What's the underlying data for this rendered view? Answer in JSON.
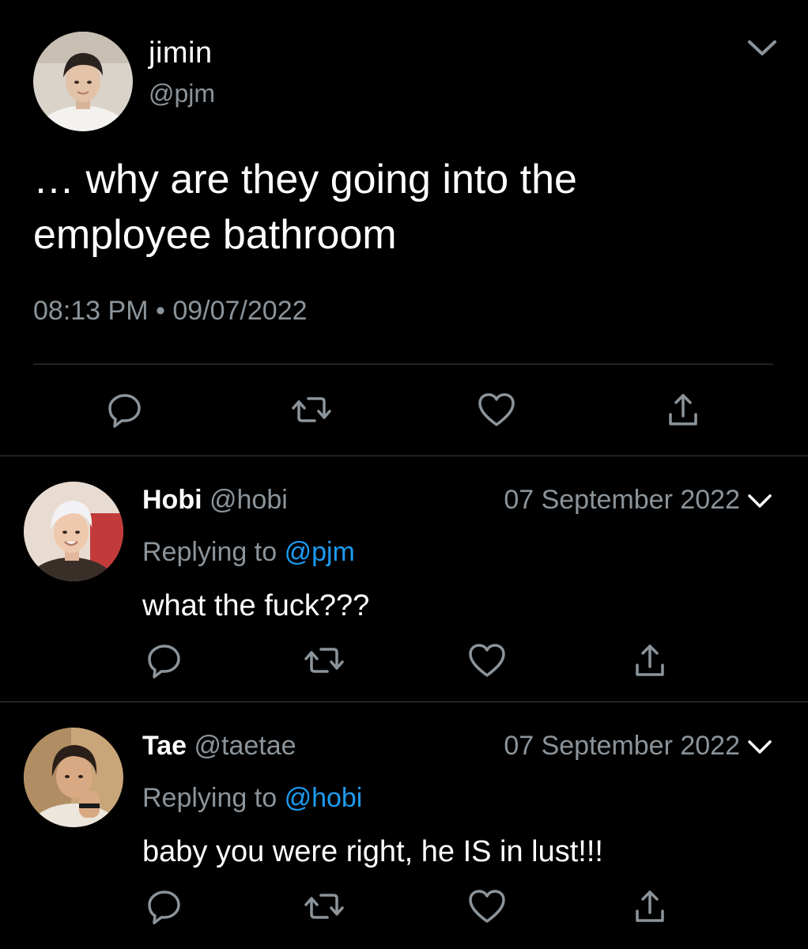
{
  "main_tweet": {
    "display_name": "jimin",
    "handle": "@pjm",
    "text": "… why are they going into the\nemployee bathroom",
    "time": "08:13 PM",
    "separator": "•",
    "date": "09/07/2022",
    "icons": {
      "menu": "chevron-down-icon",
      "reply": "reply-icon",
      "retweet": "retweet-icon",
      "like": "heart-icon",
      "share": "share-icon"
    }
  },
  "replies": [
    {
      "display_name": "Hobi",
      "handle": "@hobi",
      "date": "07 September 2022",
      "replying_label": "Replying to",
      "replying_to": "@pjm",
      "text": "what the fuck???"
    },
    {
      "display_name": "Tae",
      "handle": "@taetae",
      "date": "07 September 2022",
      "replying_label": "Replying to",
      "replying_to": "@hobi",
      "text": "baby you were right, he IS in lust!!!"
    }
  ],
  "colors": {
    "background": "#000000",
    "text": "#ffffff",
    "muted": "#8b949a",
    "mention": "#1d9bf0",
    "divider": "#3a3e42"
  }
}
